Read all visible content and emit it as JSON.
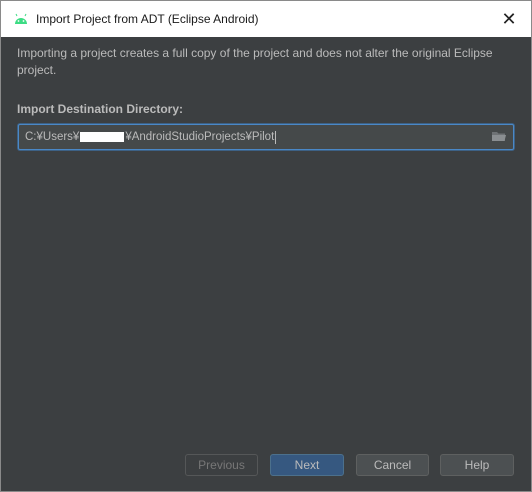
{
  "window": {
    "title": "Import Project from ADT (Eclipse Android)",
    "close_glyph": "✕",
    "icon": "android-icon"
  },
  "content": {
    "description": "Importing a project creates a full copy of the project and does not alter the original Eclipse project.",
    "destination_label": "Import Destination Directory:",
    "path_prefix": "C:¥Users¥",
    "path_suffix": "¥AndroidStudioProjects¥Pilot",
    "path_redacted": true,
    "browse_icon": "folder-icon"
  },
  "buttons": {
    "previous": "Previous",
    "next": "Next",
    "cancel": "Cancel",
    "help": "Help"
  },
  "colors": {
    "background": "#3c3f41",
    "text": "#bbbbbb",
    "accent": "#365880",
    "focus_border": "#4a88c7",
    "android_green": "#3ddc84"
  }
}
